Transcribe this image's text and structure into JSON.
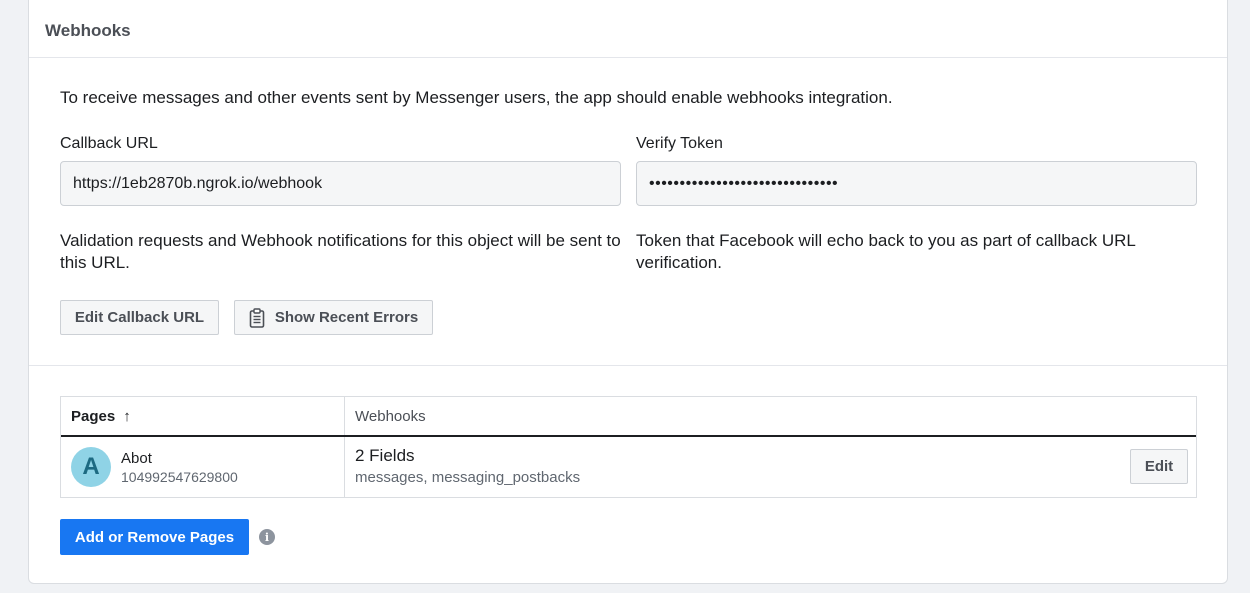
{
  "header": {
    "title": "Webhooks"
  },
  "intro_text": "To receive messages and other events sent by Messenger users, the app should enable webhooks integration.",
  "callback": {
    "label": "Callback URL",
    "value": "https://1eb2870b.ngrok.io/webhook",
    "help": "Validation requests and Webhook notifications for this object will be sent to this URL."
  },
  "verify": {
    "label": "Verify Token",
    "value": "•••••••••••••••••••••••••••••••",
    "help": "Token that Facebook will echo back to you as part of callback URL verification."
  },
  "buttons": {
    "edit_callback": "Edit Callback URL",
    "show_errors": "Show Recent Errors",
    "show_errors_icon": "clipboard-icon",
    "add_remove_pages": "Add or Remove Pages",
    "info_icon": "info-icon"
  },
  "table": {
    "columns": {
      "pages": "Pages",
      "webhooks": "Webhooks",
      "sort_icon": "arrow-up-icon"
    },
    "rows": [
      {
        "avatar_letter": "A",
        "page_name": "Abot",
        "page_id": "104992547629800",
        "fields_count": "2 Fields",
        "fields_list": "messages, messaging_postbacks",
        "edit_label": "Edit"
      }
    ]
  },
  "colors": {
    "primary": "#1877f2",
    "avatar_bg": "#8fd3e6",
    "avatar_fg": "#1d6a82"
  }
}
